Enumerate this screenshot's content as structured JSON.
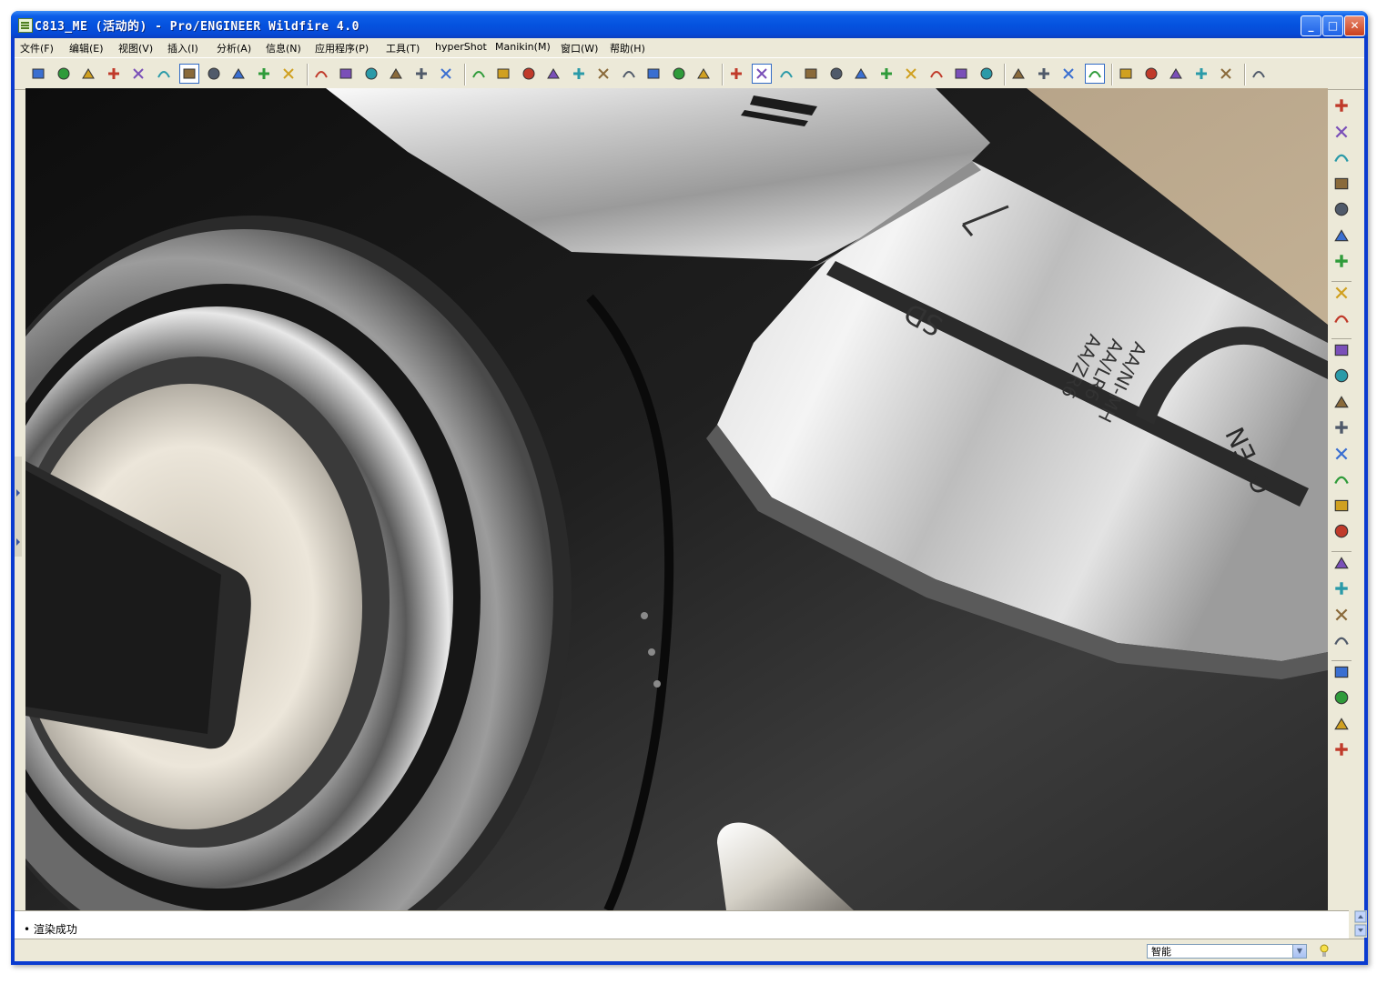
{
  "window": {
    "title": "C813_ME (活动的) - Pro/ENGINEER Wildfire 4.0",
    "controls": {
      "minimize": "_",
      "maximize": "□",
      "close": "✕"
    }
  },
  "menu": [
    "文件(F)",
    "编辑(E)",
    "视图(V)",
    "插入(I)",
    "分析(A)",
    "信息(N)",
    "应用程序(P)",
    "工具(T)",
    "hyperShot",
    "Manikin(M)",
    "窗口(W)",
    "帮助(H)"
  ],
  "toolbar": {
    "icons": [
      "color-appearance-icon",
      "scene-icon",
      "environment-icon",
      "lights-icon",
      "render-setup-icon",
      "room-icon",
      "render-window-icon",
      "render-region-icon",
      "rendered-view-icon",
      "spotlight-icon",
      "palette-icon",
      "new-file-icon",
      "open-file-icon",
      "save-icon",
      "print-icon",
      "mail-icon",
      "mail-attach-icon",
      "undo-icon",
      "redo-icon",
      "cut-icon",
      "copy-icon",
      "paste-icon",
      "paste-special-icon",
      "regenerate-icon",
      "regen-manager-icon",
      "find-icon",
      "select-box-icon",
      "repaint-icon",
      "spin-center-icon",
      "orient-mode-icon",
      "pan-icon",
      "zoom-in-icon",
      "zoom-out-icon",
      "refit-icon",
      "reorient-icon",
      "saved-views-icon",
      "layers-icon",
      "view-manager-icon",
      "wireframe-icon",
      "hidden-line-icon",
      "no-hidden-icon",
      "shading-icon",
      "datum-planes-icon",
      "datum-axes-icon",
      "datum-points-icon",
      "coord-sys-icon",
      "annotations-icon",
      "context-help-icon"
    ]
  },
  "right_toolbar": {
    "icons": [
      "sketched-curve-icon",
      "datum-plane-icon",
      "datum-axis-icon",
      "datum-curve-icon",
      "datum-point-icon",
      "sketched-point-icon",
      "offset-csys-icon",
      "sketch-tool-icon",
      "pattern-icon",
      "extrude-icon",
      "revolve-icon",
      "sweep-icon",
      "swept-blend-icon",
      "hole-icon",
      "shell-icon",
      "rib-icon",
      "draft-icon",
      "round-icon",
      "chamfer-icon",
      "boundary-blend-icon",
      "style-icon",
      "mirror-icon",
      "merge-icon",
      "trim-icon",
      "datum-pattern-icon"
    ]
  },
  "model": {
    "engraving_lines": [
      "AA/NI-MH",
      "AA/LR6",
      "AA/ZR6"
    ],
    "sd_label": "SD",
    "open_label": "OPEN"
  },
  "message": "渲染成功",
  "status": {
    "filter": "智能"
  }
}
